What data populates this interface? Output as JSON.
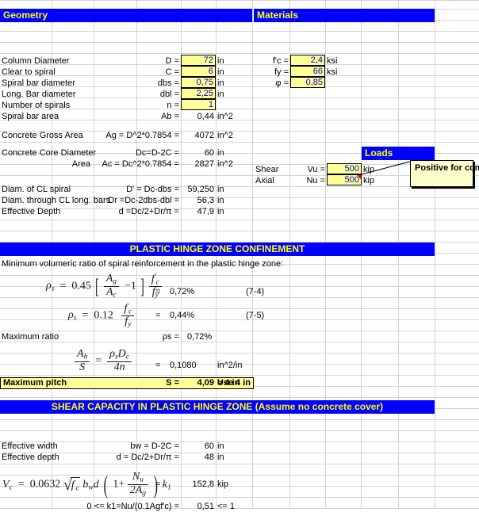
{
  "sections": {
    "geometry_title": "Geometry",
    "materials_title": "Materials",
    "loads_title": "Loads",
    "phz_title": "PLASTIC HINGE ZONE CONFINEMENT",
    "shear_title": "SHEAR CAPACITY IN PLASTIC HINGE ZONE (Assume no concrete cover)"
  },
  "geometry": {
    "rows": [
      {
        "label": "Column Diameter",
        "symbol": "D =",
        "value": "72",
        "unit": "in",
        "input": true
      },
      {
        "label": "Clear to spiral",
        "symbol": "C =",
        "value": "6",
        "unit": "in",
        "input": true
      },
      {
        "label": "Spiral bar diameter",
        "symbol": "dbs =",
        "value": "0,75",
        "unit": "in",
        "input": true
      },
      {
        "label": "Long. Bar diameter",
        "symbol": "dbl =",
        "value": "2,25",
        "unit": "in",
        "input": true
      },
      {
        "label": "Number of spirals",
        "symbol": "n =",
        "value": "1",
        "unit": "",
        "input": true
      },
      {
        "label": "Spiral bar area",
        "symbol": "Ab =",
        "value": "0,44",
        "unit": "in^2",
        "input": false
      }
    ],
    "areas": [
      {
        "label": "Concrete Gross Area",
        "symbol": "Ag = D^2*0.7854 =",
        "value": "4072",
        "unit": "in^2"
      },
      {
        "label": "Concrete Core  Diameter",
        "symbol": "Dc=D-2C =",
        "value": "60",
        "unit": "in"
      },
      {
        "label": "Area",
        "symbol": "Ac = Dc^2*0.7854 =",
        "value": "2827",
        "unit": "in^2"
      }
    ],
    "diameters": [
      {
        "label": "Diam. of CL spiral",
        "symbol": "D' = Dc-dbs =",
        "value": "59,250",
        "unit": "in"
      },
      {
        "label": "Diam. through CL long. bars",
        "symbol": "Dr =Dc-2dbs-dbl =",
        "value": "56,3",
        "unit": "in"
      },
      {
        "label": "Effective Depth",
        "symbol": "d =Dc/2+Dr/π =",
        "value": "47,9",
        "unit": "in"
      }
    ]
  },
  "materials": {
    "rows": [
      {
        "symbol": "f'c =",
        "value": "2,4",
        "unit": "ksi"
      },
      {
        "symbol": "fy =",
        "value": "66",
        "unit": "ksi"
      },
      {
        "symbol": "φ =",
        "value": "0,85",
        "unit": ""
      }
    ]
  },
  "loads": {
    "rows": [
      {
        "label": "Shear",
        "symbol": "Vu =",
        "value": "500",
        "unit": "kip"
      },
      {
        "label": "Axial",
        "symbol": "Nu =",
        "value": "500",
        "unit": "kip"
      }
    ],
    "comment": "Positive for compression"
  },
  "phz": {
    "intro": "Minimum volumeric ratio of spiral reinforcement in the plastic hinge zone:",
    "eq74": {
      "equals": "=",
      "result": "0,72%",
      "ref": "(7-4)",
      "coef": "0.45",
      "rho": "ρ",
      "sub": "s"
    },
    "eq75": {
      "equals": "=",
      "result": "0,44%",
      "ref": "(7-5)",
      "coef": "0.12"
    },
    "max_ratio": {
      "label": "Maximum ratio",
      "symbol": "ρs =",
      "value": "0,72%"
    },
    "ab_over_s": {
      "equals": "=",
      "result": "0,1080",
      "unit": "in^2/in"
    },
    "max_pitch": {
      "label": "Maximum pitch",
      "symbol": "S =",
      "value": "4,09",
      "compare": "> 4 in",
      "note": "Use 4 in"
    }
  },
  "shear": {
    "rows": [
      {
        "label": "Effective width",
        "symbol": "bw = D-2C =",
        "value": "60",
        "unit": "in"
      },
      {
        "label": "Effective depth",
        "symbol": "d = Dc/2+Dr/π =",
        "value": "48",
        "unit": "in"
      }
    ],
    "vc": {
      "coef": "0.0632",
      "equals": "=",
      "result": "152,8",
      "unit": "kip"
    },
    "k1": {
      "label": "0 <=  k1=Nu/(0.1Agf'c) =",
      "value": "0,51",
      "compare": "<= 1"
    }
  },
  "colors": {
    "banner_bg": "#0000ff",
    "banner_fg": "#ffff00",
    "input_bg": "#ffff99",
    "input_fg": "#0000cc",
    "comment_bg": "#ffffcc",
    "grid": "#d4d4d4"
  }
}
